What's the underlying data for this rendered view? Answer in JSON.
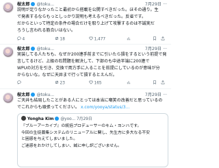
{
  "tweets": [
    {
      "name": "桜太郎",
      "handle": "@toku...",
      "date": "7月29日",
      "lines": [
        "説明が足りなかったこと最初から搭載を公開すべきだった。ほその通り。生",
        "で発表するならもっとしっかり説明も考えるべきだった。反省です。",
        "だからといって特定の条件の場合だけを取り上げて攻撃するのは不誠実だ",
        "ろうし言われる筋合いはない。"
      ],
      "reply_count": "4",
      "retweet_count": "18",
      "like_count": "1,477",
      "views": ""
    },
    {
      "name": "桜太郎",
      "handle": "@toku...",
      "date": "7月29日",
      "lines": [
        "実装してる人たちも、なぜか200連手前までに引いたら損をするという前提で発",
        "言してるけど、上級の石問題を解決して、下部のも中途半端に200連で",
        "WPUの対方を引き、交換で両方手に入ることを前提にしているのが意味が分",
        "からないな。なぜに天井まで行って損するとえんだ。"
      ],
      "reply_count": "",
      "retweet_count": "23",
      "like_count": "165",
      "views": ""
    },
    {
      "name": "桜太郎",
      "handle": "@toku...",
      "date": "7月29日",
      "lines": [
        "ご天井も結局したことがある人にとっては本当に嘲笑の改善だと思っているの",
        "でこれからも頑張ってください。"
      ],
      "link": "x.com/yooya/status/3...",
      "quote": {
        "name": "Yongha Kim",
        "handle": "@yoo...",
        "date": "7月29日",
        "lines": [
          "『ブルーアーカイブ』の統括プロデューサーのキム・ヨンハです。",
          "今回の生徒募集システムのリニューアルに関し、先生方に多大なる不安",
          "と困惑を与えてしまいました。",
          "ご迷惑をおかけしてしまい、誠に申し訳ございません。"
        ]
      }
    }
  ]
}
